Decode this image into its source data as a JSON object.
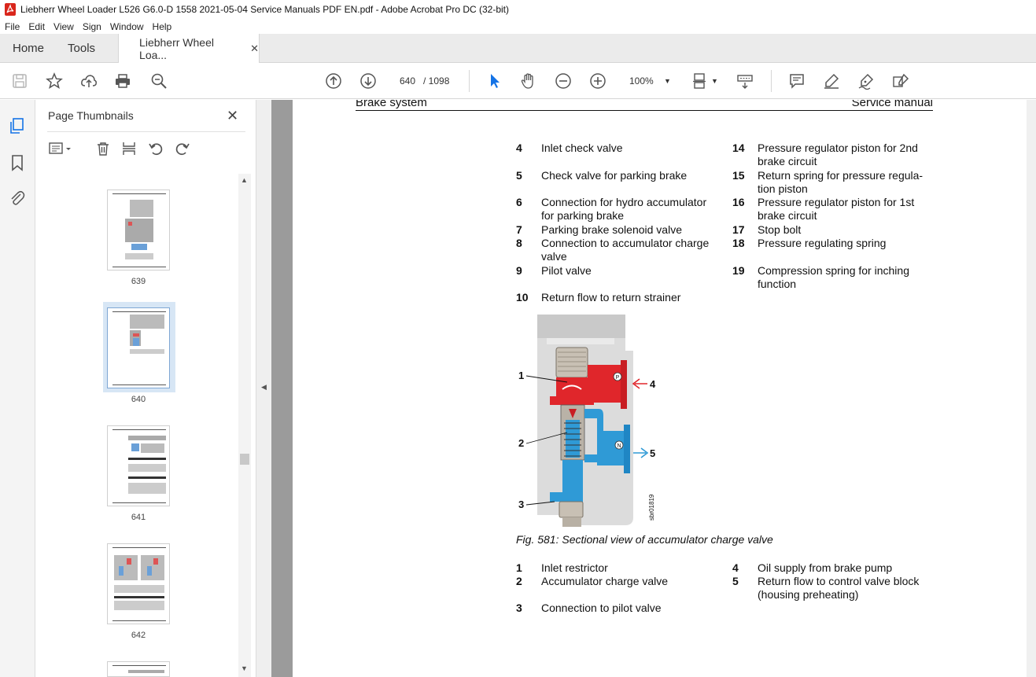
{
  "window": {
    "title": "Liebherr Wheel Loader L526 G6.0-D 1558 2021-05-04 Service Manuals PDF EN.pdf - Adobe Acrobat Pro DC (32-bit)"
  },
  "menu": [
    "File",
    "Edit",
    "View",
    "Sign",
    "Window",
    "Help"
  ],
  "tabs": {
    "home": "Home",
    "tools": "Tools",
    "document": "Liebherr Wheel Loa..."
  },
  "toolbar": {
    "page_current": "640",
    "page_total": "/ 1098",
    "zoom": "100%"
  },
  "panel": {
    "title": "Page Thumbnails",
    "thumbnails": [
      {
        "label": "639"
      },
      {
        "label": "640",
        "selected": true
      },
      {
        "label": "641"
      },
      {
        "label": "642"
      }
    ]
  },
  "document": {
    "header_left": "Brake system",
    "header_right": "Service manual",
    "legend_left": [
      {
        "num": "4",
        "text": "Inlet check valve"
      },
      {
        "num": "5",
        "text": "Check valve for parking brake"
      },
      {
        "num": "6",
        "text": "Connection for hydro accumulator for parking brake"
      },
      {
        "num": "7",
        "text": "Parking brake solenoid valve"
      },
      {
        "num": "8",
        "text": "Connection to accumulator charge valve"
      },
      {
        "num": "9",
        "text": "Pilot valve"
      },
      {
        "num": "10",
        "text": "Return flow to return strainer"
      }
    ],
    "legend_right": [
      {
        "num": "14",
        "text": "Pressure regulator piston for 2nd brake circuit"
      },
      {
        "num": "15",
        "text": "Return spring for pressure regula-tion piston"
      },
      {
        "num": "16",
        "text": "Pressure regulator piston for 1st brake circuit"
      },
      {
        "num": "17",
        "text": "Stop bolt"
      },
      {
        "num": "18",
        "text": "Pressure regulating spring"
      },
      {
        "num": "19",
        "text": "Compression spring for inching function"
      }
    ],
    "figure": {
      "callouts": [
        "1",
        "2",
        "3",
        "4",
        "5"
      ],
      "port_p": "P",
      "port_n": "N",
      "code": "sbr01819"
    },
    "caption": "Fig. 581: Sectional view of accumulator charge valve",
    "fig_legend_left": [
      {
        "num": "1",
        "text": "Inlet restrictor"
      },
      {
        "num": "2",
        "text": "Accumulator charge valve"
      },
      {
        "num": "3",
        "text": "Connection to pilot valve"
      }
    ],
    "fig_legend_right": [
      {
        "num": "4",
        "text": "Oil supply from brake pump"
      },
      {
        "num": "5",
        "text": "Return flow to control valve block (housing preheating)"
      }
    ]
  },
  "colors": {
    "red": "#e0262b",
    "blue": "#2f9ad6",
    "accent": "#1473e6"
  }
}
